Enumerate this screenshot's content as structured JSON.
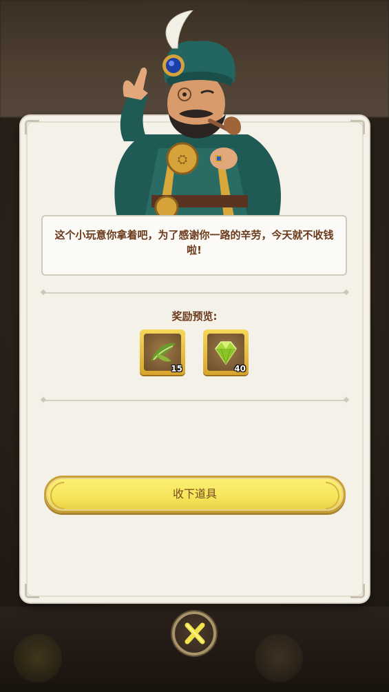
{
  "dialog": {
    "message": "这个小玩意你拿着吧，为了感谢你一路的辛劳，今天就不收钱啦!",
    "reward_title": "奖励预览:",
    "rewards": [
      {
        "icon": "feather-leaf-icon",
        "quantity": "15"
      },
      {
        "icon": "green-gem-icon",
        "quantity": "40"
      }
    ],
    "collect_label": "收下道具"
  },
  "colors": {
    "text_brown": "#6b3a1c",
    "button_yellow": "#f6e55a",
    "gold_frame": "#d8a52c",
    "panel_bg": "#f4f1e8"
  }
}
